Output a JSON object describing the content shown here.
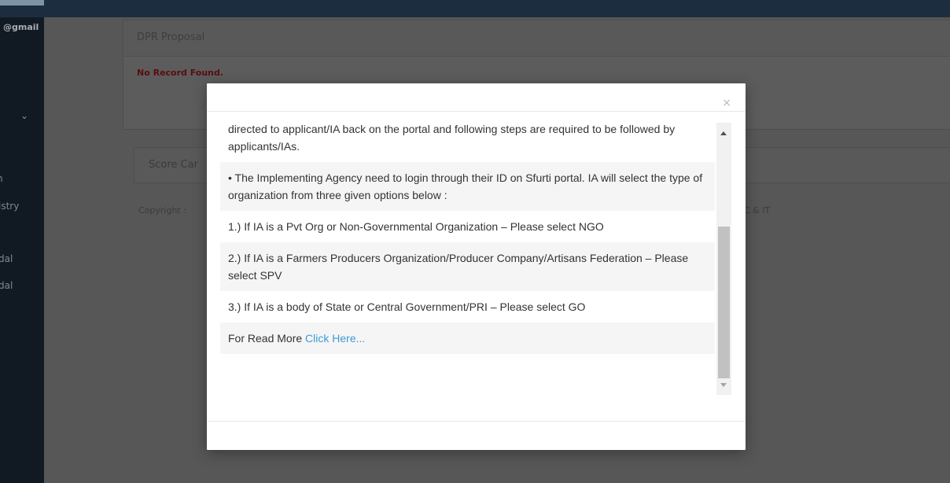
{
  "sidebar": {
    "email": "@gmail",
    "items": [
      "n",
      "istry",
      "dal",
      "dal"
    ]
  },
  "panel": {
    "title": "DPR Proposal",
    "no_record": "No Record Found."
  },
  "score_card": {
    "title": "Score Car"
  },
  "footer": {
    "copyright": "Copyright :",
    "right_text": "C & IT"
  },
  "modal": {
    "close": "×",
    "rows": [
      {
        "text": "directed to applicant/IA back on the portal and following steps are required to be followed by applicants/IAs."
      },
      {
        "text": "• The Implementing Agency need to login through their ID on Sfurti portal. IA will select the type of organization from three given options below :"
      },
      {
        "text": "1.) If IA is a Pvt Org or Non-Governmental Organization – Please select NGO"
      },
      {
        "text": "2.) If IA is a Farmers Producers Organization/Producer Company/Artisans Federation – Please select SPV"
      },
      {
        "text": "3.) If IA is a body of State or Central Government/PRI – Please select GO"
      }
    ],
    "read_more_prefix": "For Read More ",
    "read_more_link": "Click Here..."
  },
  "colors": {
    "link": "#3c9bd6",
    "no_record": "#c00000",
    "topbar": "#1c2d3f"
  }
}
